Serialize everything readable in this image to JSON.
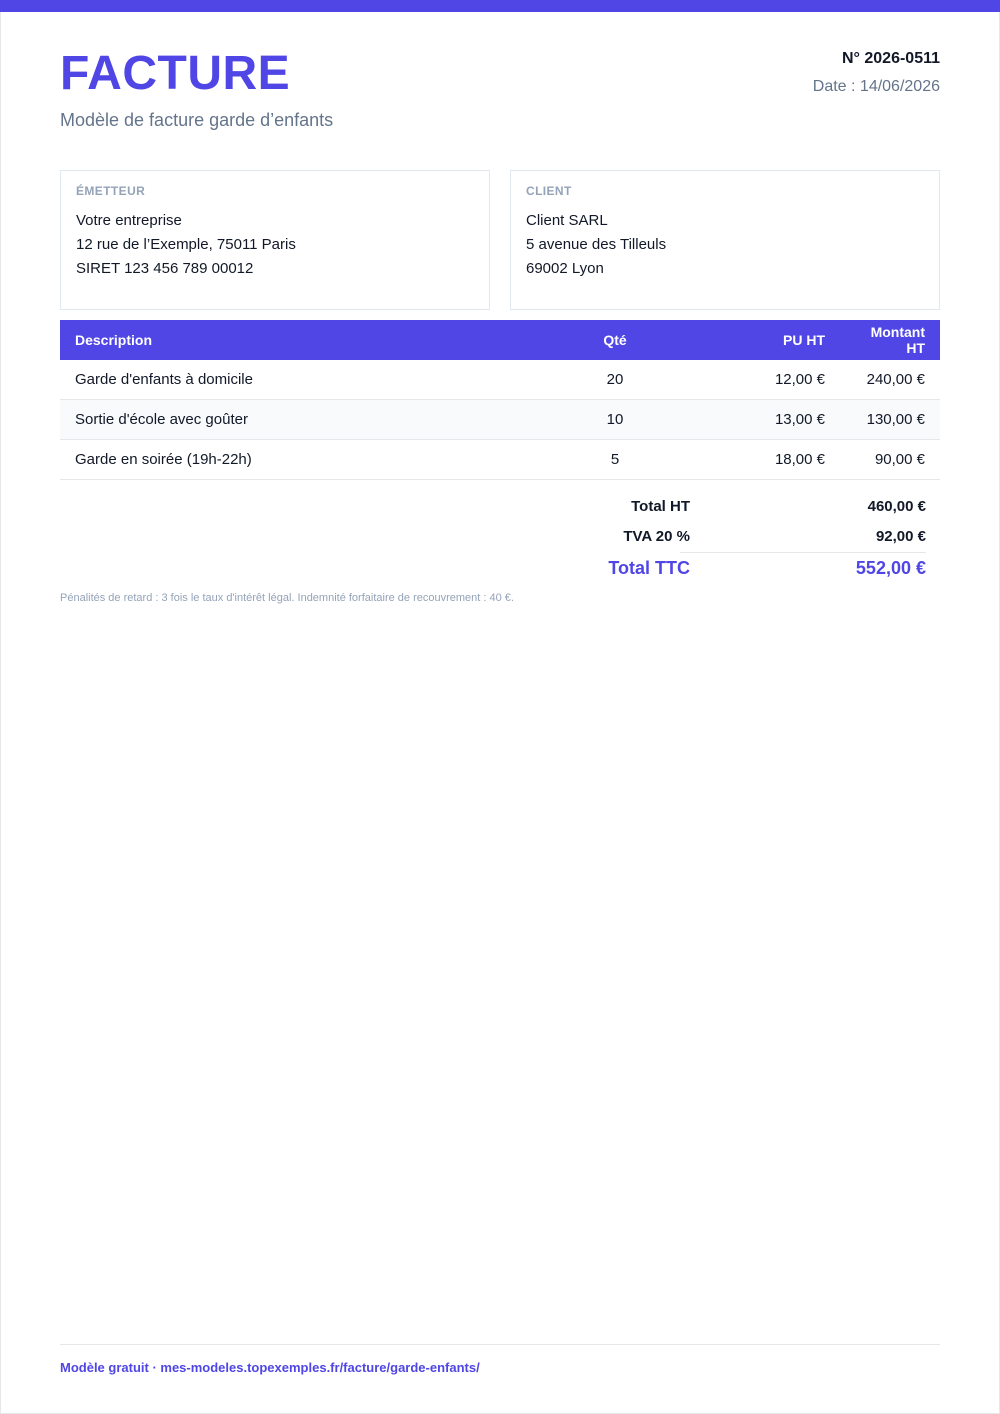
{
  "document": {
    "title": "FACTURE",
    "subtitle": "Modèle de facture garde d’enfants",
    "number": "N° 2026-0511",
    "date": "Date : 14/06/2026",
    "accent_color": "#4f46e5"
  },
  "emitter": {
    "label": "ÉMETTEUR",
    "lines": [
      "Votre entreprise",
      "12 rue de l’Exemple, 75011 Paris",
      "SIRET 123 456 789 00012"
    ]
  },
  "client": {
    "label": "CLIENT",
    "lines": [
      "Client SARL",
      "5 avenue des Tilleuls",
      "69002 Lyon"
    ]
  },
  "table": {
    "headers": [
      "Description",
      "Qté",
      "PU HT",
      "Montant HT"
    ],
    "rows": [
      [
        "Garde d'enfants à domicile",
        "20",
        "12,00 €",
        "240,00 €"
      ],
      [
        "Sortie d'école avec goûter",
        "10",
        "13,00 €",
        "130,00 €"
      ],
      [
        "Garde en soirée (19h-22h)",
        "5",
        "18,00 €",
        "90,00 €"
      ]
    ]
  },
  "totals": {
    "ht_label": "Total HT",
    "ht_value": "460,00 €",
    "tva_label": "TVA 20 %",
    "tva_value": "92,00 €",
    "ttc_label": "Total TTC",
    "ttc_value": "552,00 €"
  },
  "legal_note": "Pénalités de retard : 3 fois le taux d'intérêt légal. Indemnité forfaitaire de recouvrement : 40 €.",
  "footer": "Modèle gratuit · mes-modeles.topexemples.fr/facture/garde-enfants/"
}
